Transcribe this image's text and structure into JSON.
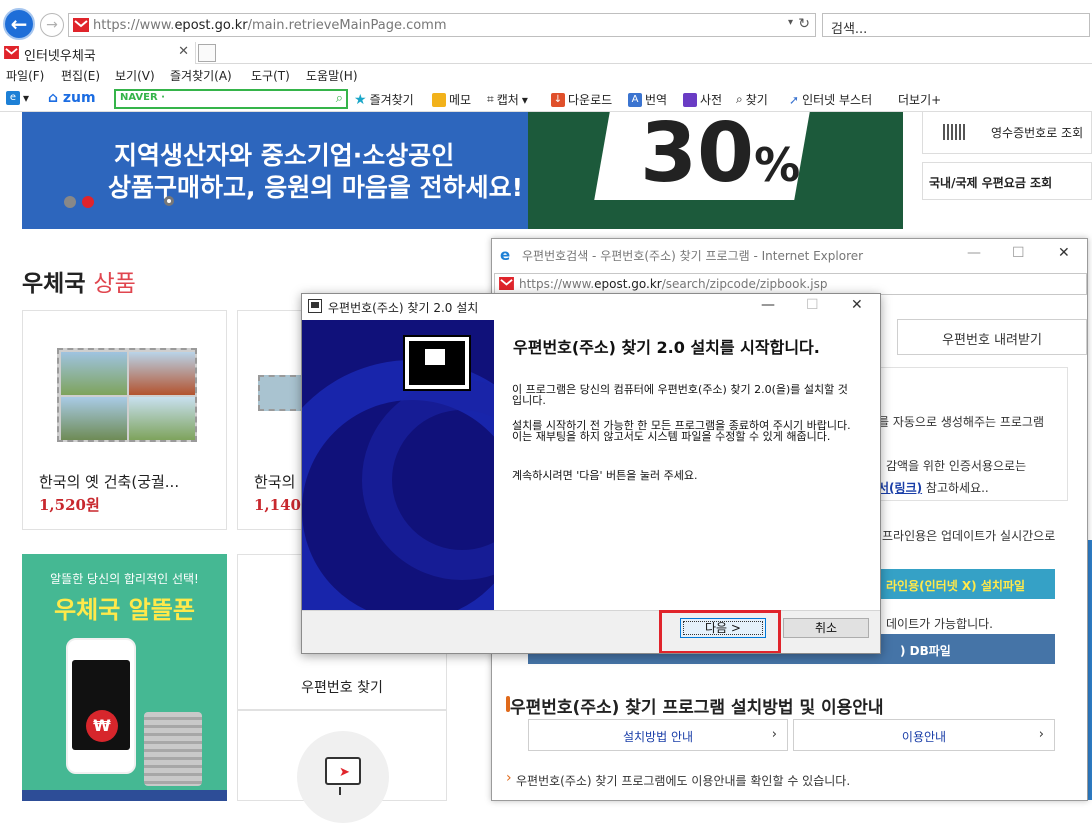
{
  "browser": {
    "address_url_pre": "https://www.",
    "address_url_domain": "epost.go.kr",
    "address_url_post": "/main.retrieveMainPage.comm",
    "search_placeholder": "검색...",
    "tab_title": "인터넷우체국",
    "menu": [
      "파일(F)",
      "편집(E)",
      "보기(V)",
      "즐겨찾기(A)",
      "도구(T)",
      "도움말(H)"
    ],
    "toolbar": {
      "zum_label": "zum",
      "naver_label": "NAVER ·",
      "favorites": "즐겨찾기",
      "memo": "메모",
      "capture": "캡처",
      "download": "다운로드",
      "translate": "번역",
      "dictionary": "사전",
      "find": "찾기",
      "booster": "인터넷 부스터",
      "more": "더보기+"
    }
  },
  "page": {
    "banner": {
      "line1": "지역생산자와 중소기업·소상공인",
      "line2": "상품구매하고, 응원의 마음을 전하세요!",
      "percent": "30",
      "percent_sign": "%"
    },
    "right_links": {
      "receipt": "영수증번호로 조회",
      "postage": "국내/국제 우편요금 조회"
    },
    "products_title_main": "우체국",
    "products_title_accent": "상품",
    "products": [
      {
        "name": "한국의 옛 건축(궁궐...",
        "price": "1,520원"
      },
      {
        "name": "한국의",
        "price": "1,140원"
      }
    ],
    "ad": {
      "subtitle": "알뜰한 당신의 합리적인 선택!",
      "title": "우체국 알뜰폰",
      "won": "₩"
    },
    "zip_card_label": "우편번호 찾기",
    "colors": {
      "banner_blue": "#2d66bd",
      "accent_red": "#e0464f",
      "ad_green": "#45b893"
    }
  },
  "zip_window": {
    "title": "우편번호검색 - 우편번호(주소) 찾기 프로그램 - Internet Explorer",
    "url_pre": "https://www.",
    "url_domain": "epost.go.kr",
    "url_post": "/search/zipcode/zipbook.jsp",
    "tab_download": "우편번호 내려받기",
    "info_line1": "를 자동으로 생성해주는 프로그램",
    "info_line2": "감액을 위한 인증서용으로는",
    "info_link": "서(링크)",
    "info_line3": "참고하세요..",
    "info_line4": "프라인용은 업데이트가 실시간으로",
    "offline_btn": "라인용(인터넷 X) 설치파일",
    "update_text": "데이트가 가능합니다.",
    "db_btn": ") DB파일",
    "guide_title": "우편번호(주소) 찾기 프로그램 설치방법 및 이용안내",
    "guide_btn1": "설치방법 안내",
    "guide_btn2": "이용안내",
    "guide_note": "우편번호(주소) 찾기 프로그램에도 이용안내를 확인할 수 있습니다."
  },
  "installer": {
    "title": "우편번호(주소) 찾기 2.0 설치",
    "heading": "우편번호(주소) 찾기 2.0 설치를 시작합니다.",
    "p1": "이 프로그램은 당신의 컴퓨터에 우편번호(주소) 찾기 2.0(을)를 설치할 것입니다.",
    "p2": "설치를 시작하기 전 가능한 한 모든 프로그램을 종료하여 주시기 바랍니다. 이는 재부팅을 하지 않고서도 시스템 파일을 수정할 수 있게 해줍니다.",
    "p3": "계속하시려면 '다음' 버튼을 눌러 주세요.",
    "next_label": "다음 >",
    "cancel_label": "취소"
  }
}
